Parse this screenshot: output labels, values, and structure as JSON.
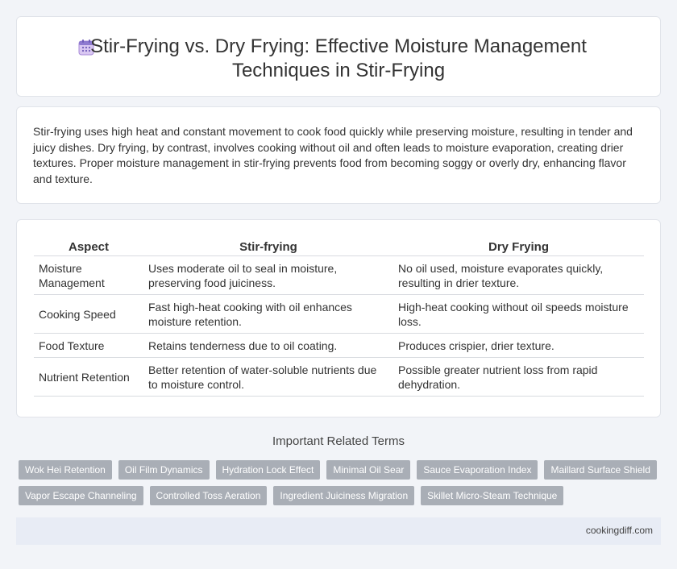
{
  "header": {
    "title_line1": "Stir-Frying vs. Dry Frying: Effective Moisture Management",
    "title_line2": "Techniques in Stir-Frying",
    "icon": "calendar-icon"
  },
  "intro": {
    "text": "Stir-frying uses high heat and constant movement to cook food quickly while preserving moisture, resulting in tender and juicy dishes. Dry frying, by contrast, involves cooking without oil and often leads to moisture evaporation, creating drier textures. Proper moisture management in stir-frying prevents food from becoming soggy or overly dry, enhancing flavor and texture."
  },
  "table": {
    "headers": [
      "Aspect",
      "Stir-frying",
      "Dry Frying"
    ],
    "rows": [
      [
        "Moisture Management",
        "Uses moderate oil to seal in moisture, preserving food juiciness.",
        "No oil used, moisture evaporates quickly, resulting in drier texture."
      ],
      [
        "Cooking Speed",
        "Fast high-heat cooking with oil enhances moisture retention.",
        "High-heat cooking without oil speeds moisture loss."
      ],
      [
        "Food Texture",
        "Retains tenderness due to oil coating.",
        "Produces crispier, drier texture."
      ],
      [
        "Nutrient Retention",
        "Better retention of water-soluble nutrients due to moisture control.",
        "Possible greater nutrient loss from rapid dehydration."
      ]
    ]
  },
  "related": {
    "title": "Important Related Terms",
    "tags_row1": [
      "Wok Hei Retention",
      "Oil Film Dynamics",
      "Hydration Lock Effect",
      "Minimal Oil Sear",
      "Sauce Evaporation Index",
      "Maillard Surface Shield"
    ],
    "tags_row2": [
      "Vapor Escape Channeling",
      "Controlled Toss Aeration",
      "Ingredient Juiciness Migration",
      "Skillet Micro-Steam Technique"
    ]
  },
  "footer": {
    "site": "cookingdiff.com"
  },
  "colors": {
    "background": "#f2f4f8",
    "tag": "#a9aeb6",
    "footer": "#e8ecf5"
  }
}
